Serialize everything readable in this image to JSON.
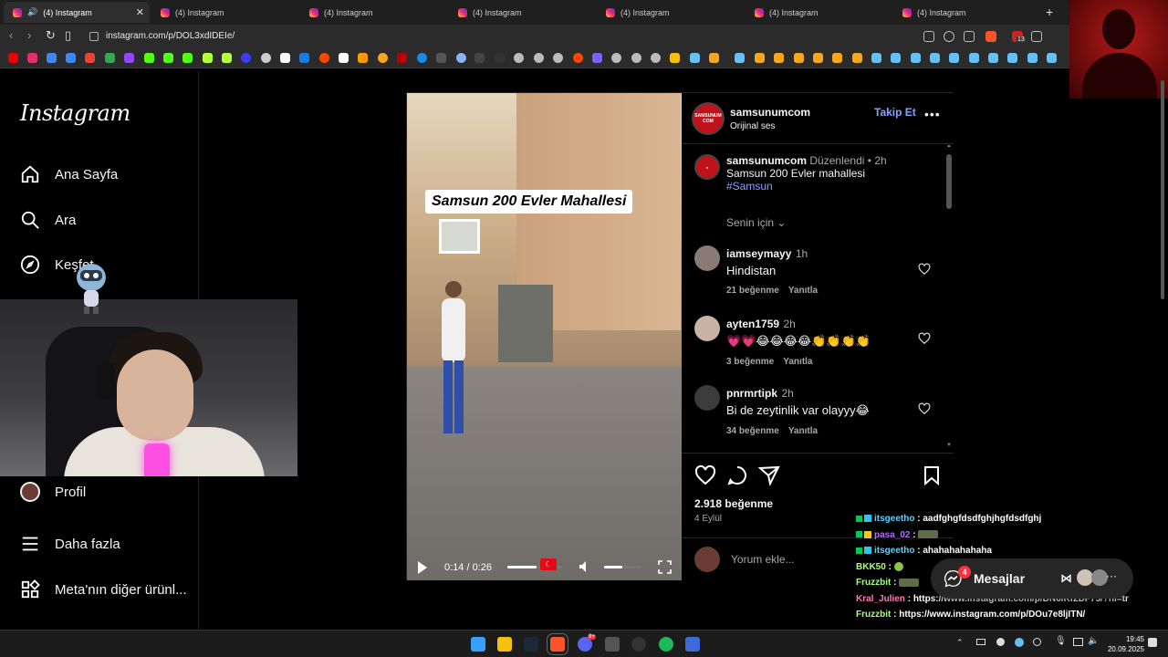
{
  "browser": {
    "tabs": [
      {
        "label": "(4) Instagram",
        "active": true
      },
      {
        "label": "(4) Instagram"
      },
      {
        "label": "(4) Instagram"
      },
      {
        "label": "(4) Instagram"
      },
      {
        "label": "(4) Instagram"
      },
      {
        "label": "(4) Instagram"
      },
      {
        "label": "(4) Instagram"
      }
    ],
    "new_tab": "+",
    "url": "instagram.com/p/DOL3xdIDEIe/",
    "extension_badge": "13"
  },
  "sidebar": {
    "logo": "Instagram",
    "items": [
      {
        "label": "Ana Sayfa",
        "icon": "home-icon"
      },
      {
        "label": "Ara",
        "icon": "search-icon"
      },
      {
        "label": "Keşfet",
        "icon": "compass-icon"
      },
      {
        "label": "Profil",
        "icon": "avatar"
      },
      {
        "label": "Daha fazla",
        "icon": "menu-icon"
      },
      {
        "label": "Meta'nın diğer ürünl...",
        "icon": "grid-icon"
      }
    ]
  },
  "post": {
    "video_overlay_title": "Samsun 200 Evler Mahallesi",
    "video_time": "0:14 / 0:26",
    "video_progress": 0.54,
    "volume_level": 0.5,
    "author": "samsunumcom",
    "audio": "Orijinal ses",
    "follow_label": "Takip Et",
    "more_label": "•••",
    "brand_avatar_text": "SAMSUNUM COM",
    "caption": {
      "author": "samsunumcom",
      "edited": "Düzenlendi",
      "dot": "•",
      "time": "2h",
      "text": "Samsun 200 Evler mahallesi",
      "hashtag": "#Samsun"
    },
    "comment_filter": "Senin için",
    "comments": [
      {
        "user": "iamseymayy",
        "time": "1h",
        "text": "Hindistan",
        "likes": "21 beğenme",
        "reply": "Yanıtla"
      },
      {
        "user": "ayten1759",
        "time": "2h",
        "text": "💗💗😂😂😂😂👏👏👏👏",
        "likes": "3 beğenme",
        "reply": "Yanıtla"
      },
      {
        "user": "pnrmrtipk",
        "time": "2h",
        "text": "Bi de zeytinlik var olayyy😂",
        "likes": "34 beğenme",
        "reply": "Yanıtla"
      }
    ],
    "likes_count": "2.918 beğenme",
    "date": "4 Eylül",
    "comment_placeholder": "Yorum ekle..."
  },
  "messages": {
    "label": "Mesajlar",
    "badge": "4"
  },
  "chat": [
    {
      "user": "itsgeetho",
      "color": "#5ad1ff",
      "text": "aadfghgfdsdfghjhgfdsdfghj"
    },
    {
      "user": "pasa_02",
      "color": "#b46cff",
      "text": ""
    },
    {
      "user": "itsgeetho",
      "color": "#5ad1ff",
      "text": "ahahahahahaha"
    },
    {
      "user": "BKK50",
      "color": "#a8ff7a",
      "text": ""
    },
    {
      "user": "Fruzzbit",
      "color": "#a8ff7a",
      "text": ""
    },
    {
      "user": "Kral_Julien",
      "color": "#ff7ab4",
      "text": "https://www.instagram.com/p/DN6iKf2DF75/?hl=tr"
    },
    {
      "user": "Fruzzbit",
      "color": "#a8ff7a",
      "text": "https://www.instagram.com/p/DOu7e8ljITN/"
    }
  ],
  "taskbar": {
    "time": "19:45",
    "date": "20.09.2025",
    "discord_badge": "9+"
  },
  "colors": {
    "background": "#000000",
    "accent_link": "#8aa0ff",
    "notification": "#ff3040"
  }
}
